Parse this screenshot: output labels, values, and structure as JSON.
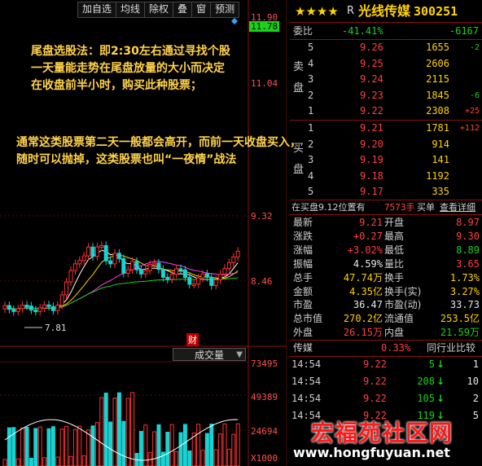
{
  "toolbar": {
    "items": [
      "加自选",
      "均线",
      "除权",
      "叠",
      "窗",
      "预测"
    ]
  },
  "price_axis": {
    "high_label": "11.90",
    "current_label": "11.78",
    "level_label": "11.04",
    "label_932": "9.32",
    "label_846": "8.46",
    "low_marker": "7.81"
  },
  "annotation": {
    "line1": "尾盘选股法：即2:30左右通过寻找个股",
    "line2": "一天量能走势在尾盘放量的大小而决定",
    "line3": "在收盘前半小时，购买此种股票；",
    "line4": "通常这类股票第二天一般都会高开，而前一天收盘买入，",
    "line5": "随时可以抛掉，这类股票也叫“一夜情”战法"
  },
  "volume": {
    "tab_label": "成交量",
    "v1": "73495",
    "v2": "49389",
    "v3": "24694",
    "unit": "X1000",
    "fin_marker": "财"
  },
  "header": {
    "stars": "★★★★",
    "r_mark": "R",
    "name": "光线传媒",
    "code": "300251"
  },
  "weibi": {
    "label": "委比",
    "pct": "-41.41%",
    "diff": "-6167"
  },
  "sell_side_label": "卖盘",
  "buy_side_label": "买盘",
  "asks": [
    {
      "lvl": "5",
      "price": "9.26",
      "vol": "1655",
      "chg": "-2"
    },
    {
      "lvl": "4",
      "price": "9.25",
      "vol": "2606",
      "chg": ""
    },
    {
      "lvl": "3",
      "price": "9.24",
      "vol": "2115",
      "chg": ""
    },
    {
      "lvl": "2",
      "price": "9.23",
      "vol": "1845",
      "chg": "-6"
    },
    {
      "lvl": "1",
      "price": "9.22",
      "vol": "2308",
      "chg": "+25"
    }
  ],
  "bids": [
    {
      "lvl": "1",
      "price": "9.21",
      "vol": "1781",
      "chg": "+112"
    },
    {
      "lvl": "2",
      "price": "9.20",
      "vol": "914",
      "chg": ""
    },
    {
      "lvl": "3",
      "price": "9.19",
      "vol": "141",
      "chg": ""
    },
    {
      "lvl": "4",
      "price": "9.18",
      "vol": "1192",
      "chg": ""
    },
    {
      "lvl": "5",
      "price": "9.17",
      "vol": "335",
      "chg": ""
    }
  ],
  "position_bar": {
    "text": "在买盘9.12位置有",
    "vol": "7573手",
    "ask": "买单",
    "view": "查看详细"
  },
  "stats": [
    {
      "l1": "最新",
      "v1": "9.21",
      "c1": "red",
      "l2": "开盘",
      "v2": "8.97",
      "c2": "red"
    },
    {
      "l1": "涨跌",
      "v1": "+0.27",
      "c1": "red",
      "l2": "最高",
      "v2": "9.30",
      "c2": "red"
    },
    {
      "l1": "涨幅",
      "v1": "+3.02%",
      "c1": "red",
      "l2": "最低",
      "v2": "8.89",
      "c2": "grn"
    },
    {
      "l1": "振幅",
      "v1": "4.59%",
      "c1": "wht",
      "l2": "量比",
      "v2": "3.65",
      "c2": "red"
    },
    {
      "l1": "总手",
      "v1": "47.74万",
      "c1": "yel",
      "l2": "换手",
      "v2": "1.73%",
      "c2": "yel"
    },
    {
      "l1": "金额",
      "v1": "4.35亿",
      "c1": "yel",
      "l2": "换手(实)",
      "v2": "3.27%",
      "c2": "yel"
    },
    {
      "l1": "市盈",
      "v1": "36.47",
      "c1": "wht",
      "l2": "市盈(动)",
      "v2": "33.73",
      "c2": "wht"
    },
    {
      "l1": "总市值",
      "v1": "270.2亿",
      "c1": "yel",
      "l2": "流通值",
      "v2": "253.5亿",
      "c2": "yel"
    },
    {
      "l1": "外盘",
      "v1": "26.15万",
      "c1": "red",
      "l2": "内盘",
      "v2": "21.59万",
      "c2": "grn"
    }
  ],
  "chuanbiao": {
    "label": "传媒",
    "pct": "0.33%",
    "peer": "同行业比较"
  },
  "ticks": [
    {
      "time": "14:54",
      "price": "9.22",
      "vol": "5",
      "dir": "down",
      "n": "1"
    },
    {
      "time": "14:54",
      "price": "9.22",
      "vol": "208",
      "dir": "down",
      "n": "10"
    },
    {
      "time": "14:54",
      "price": "9.22",
      "vol": "105",
      "dir": "down",
      "n": "2"
    },
    {
      "time": "14:54",
      "price": "9.22",
      "vol": "119",
      "dir": "down",
      "n": "5"
    }
  ],
  "watermark": {
    "name": "宏福苑社区网",
    "url": "www.hongfuyuan.net"
  },
  "colors": {
    "up": "#ff4040",
    "down": "#19d219",
    "accent": "#ffd200",
    "bg": "#000000"
  }
}
